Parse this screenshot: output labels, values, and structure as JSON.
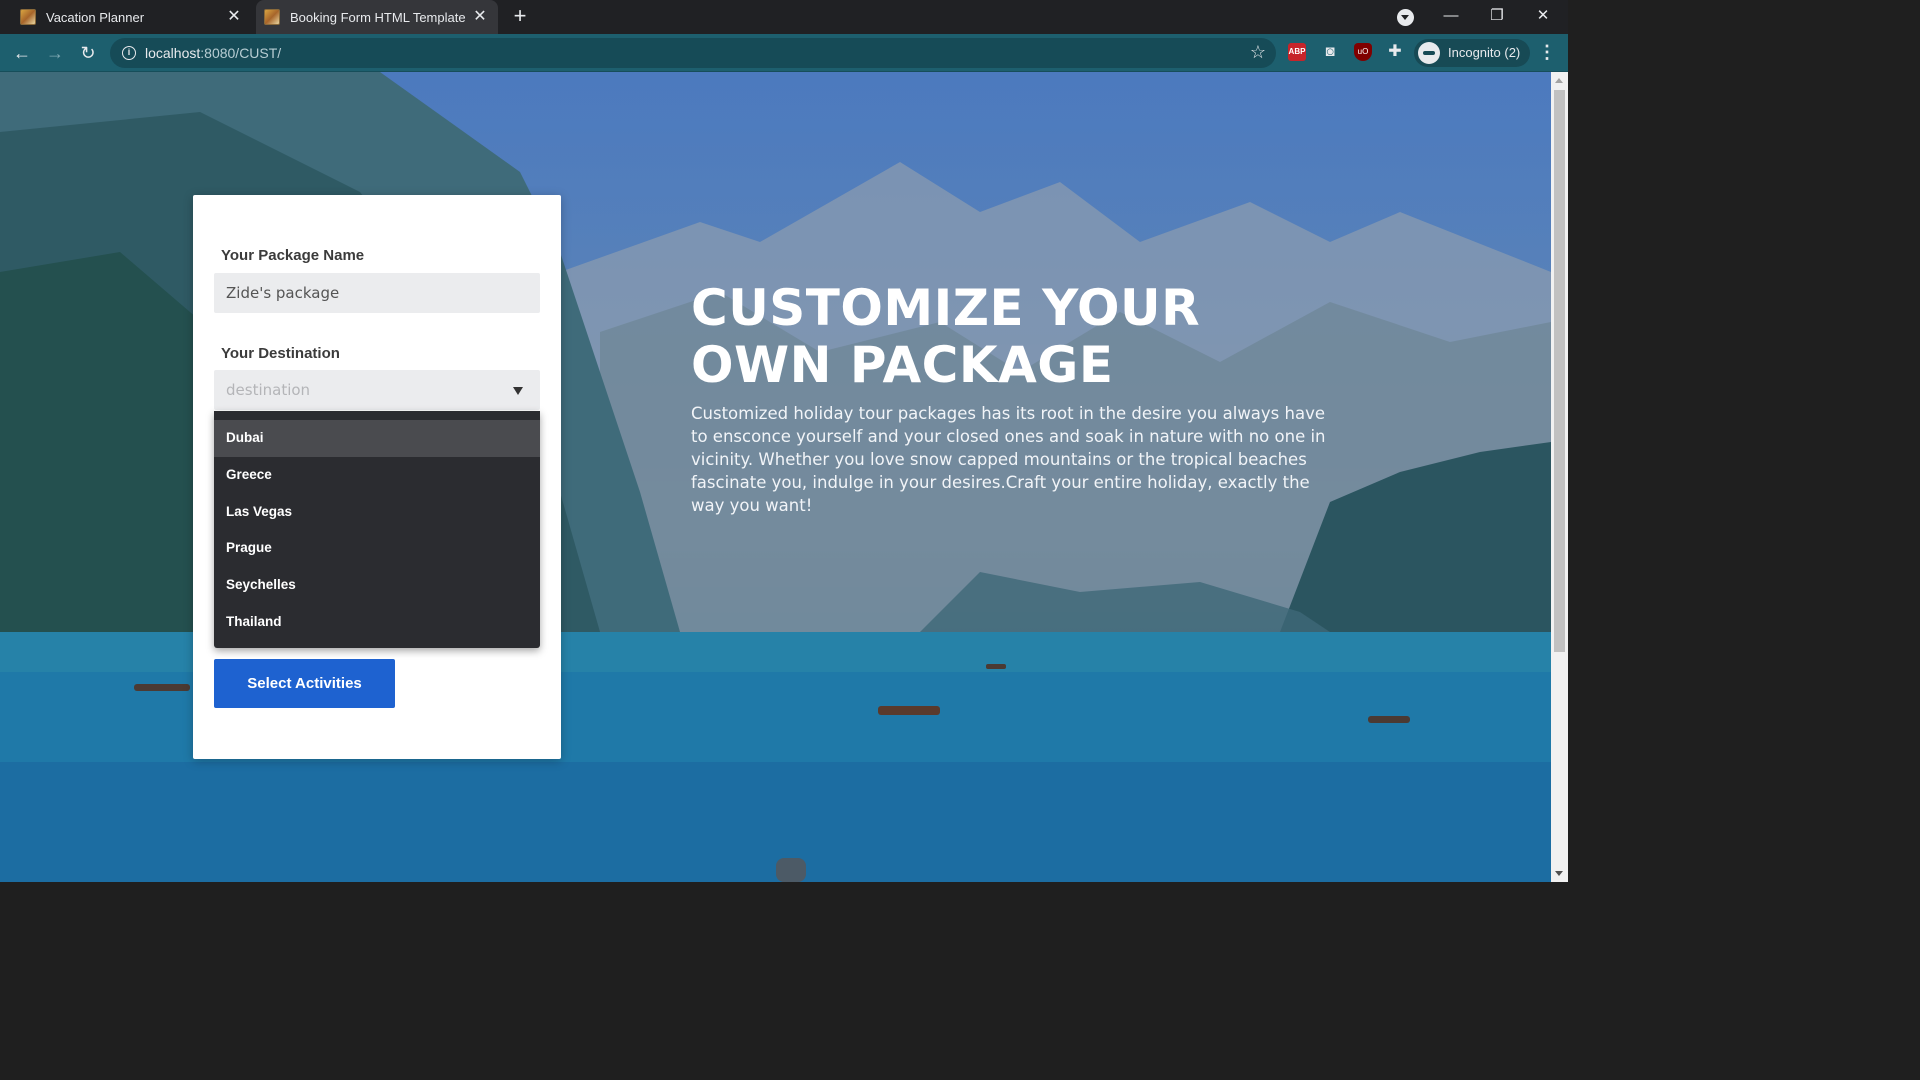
{
  "browser": {
    "tabs": [
      {
        "title": "Vacation Planner",
        "favicon": "vacation-favicon",
        "active": false
      },
      {
        "title": "Booking Form HTML Template",
        "favicon": "vacation-favicon",
        "active": true
      }
    ],
    "address": {
      "host": "localhost",
      "path": ":8080/CUST/"
    },
    "profile_label": "Incognito (2)",
    "icons": [
      "back-icon",
      "forward-icon",
      "reload-icon",
      "info-icon",
      "bookmark-star-icon",
      "adblock-icon",
      "camera-icon",
      "ublock-icon",
      "extensions-puzzle-icon",
      "incognito-icon",
      "more-menu-icon",
      "new-tab-icon",
      "minimize-icon",
      "restore-icon",
      "close-window-icon"
    ],
    "accent_colors": {
      "tabbar": "#202124",
      "toolbar": "#1d5f6e"
    }
  },
  "form": {
    "package_label": "Your Package Name",
    "package_value": "Zide's package",
    "destination_label": "Your Destination",
    "destination_placeholder": "destination",
    "destination_options": [
      "Dubai",
      "Greece",
      "Las Vegas",
      "Prague",
      "Seychelles",
      "Thailand"
    ],
    "highlighted_option": "Dubai",
    "submit_label": "Select Activities",
    "button_color": "#1e62d0"
  },
  "hero": {
    "title_line1": "CUSTOMIZE YOUR",
    "title_line2": "OWN PACKAGE",
    "description": "Customized holiday tour packages has its root in the desire you always have to ensconce yourself and your closed ones and soak in nature with no one in vicinity. Whether you love snow capped mountains or the tropical beaches fascinate you, indulge in your desires.Craft your entire holiday, exactly the way you want!"
  }
}
